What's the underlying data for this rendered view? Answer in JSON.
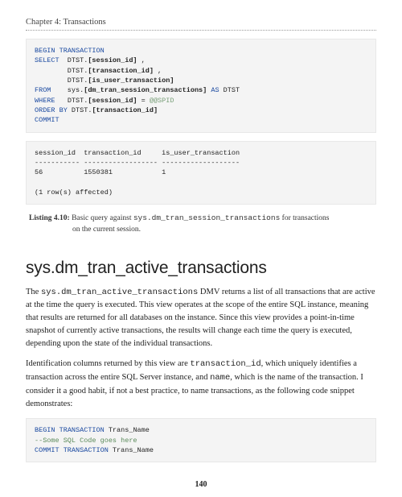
{
  "chapter_header": "Chapter 4: Transactions",
  "code1": {
    "l1a": "BEGIN",
    "l1b": " TRANSACTION",
    "l2a": "SELECT",
    "l2b": "  DTST.",
    "l2c": "[session_id]",
    "l2d": " ,",
    "l3a": "        DTST.",
    "l3b": "[transaction_id]",
    "l3c": " ,",
    "l4a": "        DTST.",
    "l4b": "[is_user_transaction]",
    "l5a": "FROM",
    "l5b": "    sys.",
    "l5c": "[dm_tran_session_transactions]",
    "l5d": " AS",
    "l5e": " DTST",
    "l6a": "WHERE",
    "l6b": "   DTST.",
    "l6c": "[session_id]",
    "l6d": " = ",
    "l6e": "@@SPID",
    "l7a": "ORDER",
    "l7b": " BY",
    "l7c": " DTST.",
    "l7d": "[transaction_id]",
    "l8a": "COMMIT"
  },
  "result1": {
    "hdr": "session_id  transaction_id     is_user_transaction",
    "sep": "----------- ------------------ -------------------",
    "row": "56          1550381            1",
    "footer": "(1 row(s) affected)"
  },
  "listing": {
    "label": "Listing 4.10:",
    "text_before": "  Basic query against ",
    "mono": "sys.dm_tran_session_transactions",
    "text_after": " for transactions",
    "line2": "on the current session."
  },
  "section_title": "sys.dm_tran_active_transactions",
  "para1": {
    "pre": "The ",
    "mono": "sys.dm_tran_active_transactions",
    "post": " DMV returns a list of all transactions that are active at the time the query is executed. This view operates at the scope of the entire SQL instance, meaning that results are returned for all databases on the instance. Since this view provides a point-in-time snapshot of currently active transactions, the results will change each time the query is executed, depending upon the state of the individual transactions."
  },
  "para2": {
    "pre": "Identification columns returned by this view are ",
    "mono1": "transaction_id",
    "mid": ", which uniquely identifies a transaction across the entire SQL Server instance, and ",
    "mono2": "name",
    "post": ", which is the name of the transaction. I consider it a good habit, if not a best practice, to name transactions, as the following code snippet demonstrates:"
  },
  "code2": {
    "l1a": "BEGIN",
    "l1b": " TRANSACTION",
    "l1c": " Trans_Name",
    "l2": "--Some SQL Code goes here",
    "l3a": "COMMIT",
    "l3b": " TRANSACTION",
    "l3c": " Trans_Name"
  },
  "page_number": "140"
}
